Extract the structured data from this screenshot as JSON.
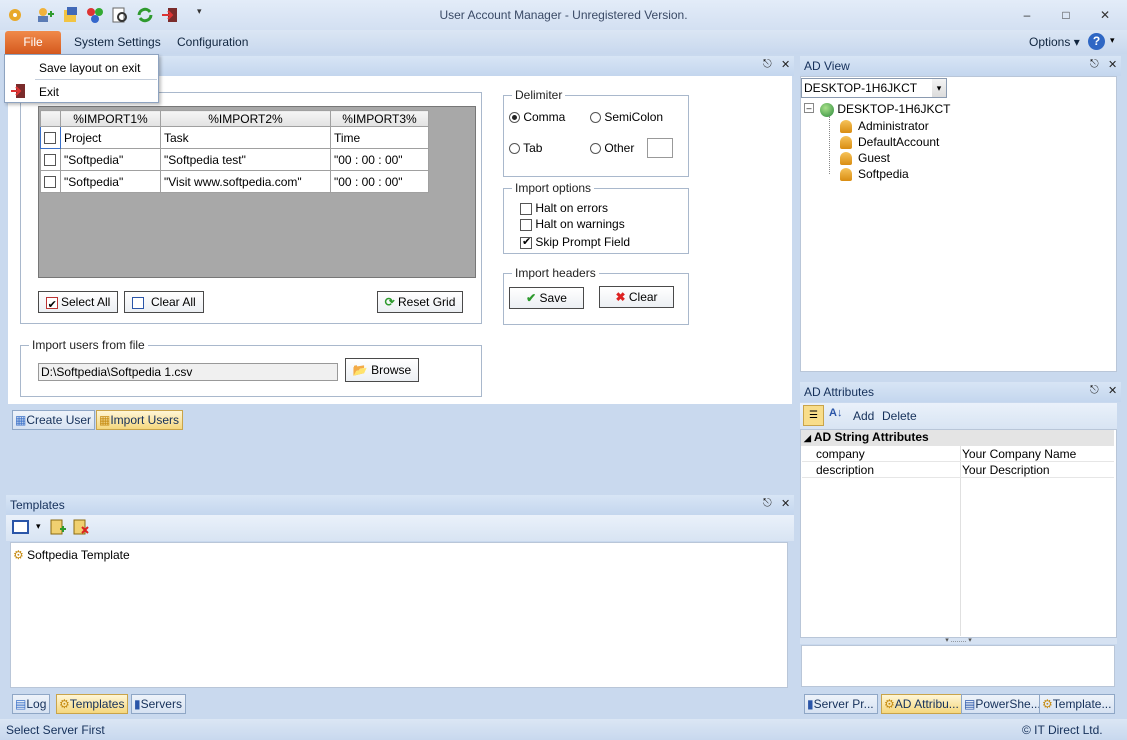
{
  "window": {
    "title": "User Account Manager - Unregistered Version."
  },
  "menubar": {
    "file": "File",
    "system_settings": "System Settings",
    "configuration": "Configuration",
    "options": "Options"
  },
  "file_menu": {
    "save_layout": "Save layout on exit",
    "exit": "Exit"
  },
  "grid": {
    "headers": [
      "%IMPORT1%",
      "%IMPORT2%",
      "%IMPORT3%"
    ],
    "rows": [
      {
        "checked": false,
        "c1": "Project",
        "c2": "Task",
        "c3": "Time"
      },
      {
        "checked": false,
        "c1": "\"Softpedia\"",
        "c2": "\"Softpedia test\"",
        "c3": "\"00 : 00 : 00\""
      },
      {
        "checked": false,
        "c1": "\"Softpedia\"",
        "c2": "\"Visit www.softpedia.com\"",
        "c3": "\"00 : 00 : 00\""
      }
    ],
    "select_all": "Select All",
    "clear_all": "Clear All",
    "reset_grid": "Reset Grid"
  },
  "delimiter": {
    "title": "Delimiter",
    "comma": "Comma",
    "semicolon": "SemiColon",
    "tab": "Tab",
    "other": "Other",
    "selected": "comma"
  },
  "import_options": {
    "title": "Import options",
    "halt_errors": "Halt on errors",
    "halt_warnings": "Halt on warnings",
    "skip_prompt": "Skip Prompt Field"
  },
  "import_headers": {
    "title": "Import headers",
    "save": "Save",
    "clear": "Clear"
  },
  "import_file": {
    "title": "Import users from file",
    "path": "D:\\Softpedia\\Softpedia 1.csv",
    "browse": "Browse"
  },
  "doc_tabs": {
    "create_user": "Create User",
    "import_users": "Import Users"
  },
  "templates": {
    "title": "Templates",
    "item": "Softpedia Template"
  },
  "bottom_tabs": {
    "log": "Log",
    "templates": "Templates",
    "servers": "Servers"
  },
  "ad_view": {
    "title": "AD View",
    "combo": "DESKTOP-1H6JKCT",
    "root": "DESKTOP-1H6JKCT",
    "users": [
      "Administrator",
      "DefaultAccount",
      "Guest",
      "Softpedia"
    ]
  },
  "ad_attributes": {
    "title": "AD Attributes",
    "add": "Add",
    "delete": "Delete",
    "category": "AD String Attributes",
    "props": [
      {
        "name": "company",
        "value": "Your Company Name"
      },
      {
        "name": "description",
        "value": "Your Description"
      }
    ]
  },
  "right_tabs": {
    "server": "Server Pr...",
    "ad_attr": "AD Attribu...",
    "powershell": "PowerShe...",
    "template": "Template..."
  },
  "status": {
    "left": "Select Server First",
    "right": "© IT Direct Ltd."
  },
  "colors": {
    "accent_file": "#e06a2c",
    "panel_head": "#c4d6ee",
    "active_tab": "#f5d77e"
  }
}
